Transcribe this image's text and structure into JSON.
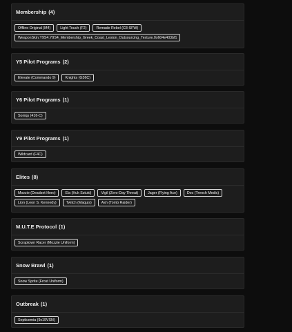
{
  "sections": [
    {
      "title": "Membership",
      "count": "(4)",
      "items": [
        "Offline Original (M4)",
        "Light Touch (F2)",
        "Remade Rebel (C8-SFW)",
        "WeaponSkin.Y9S4.Y9S4_Membership_Greek_Coast_Lesion_Outsourcing_Texture.0x604e403bf1"
      ]
    },
    {
      "title": "Y5 Pilot Programs",
      "count": "(2)",
      "items": [
        "Elevate (Commando 9)",
        "Knights (G36C)"
      ]
    },
    {
      "title": "Y6 Pilot Programs",
      "count": "(1)",
      "items": [
        "Soniqs (416-C)"
      ]
    },
    {
      "title": "Y9 Pilot Programs",
      "count": "(1)",
      "items": [
        "Wildcard (F4C)"
      ]
    },
    {
      "title": "Elites",
      "count": "(8)",
      "items": [
        "Mozzie (Deadset Hero)",
        "Ela (Huk Sztuki)",
        "Vigil (Zero-Day Threat)",
        "Jager (Flying Ace)",
        "Doc (Trench Medic)",
        "Lion (Leon S. Kennedy)",
        "Twitch (Maquis)",
        "Ash (Tomb Raider)"
      ]
    },
    {
      "title": "M.U.T.E Protocol",
      "count": "(1)",
      "items": [
        "Scraptown Racer (Mozzie Uniform)"
      ]
    },
    {
      "title": "Snow Brawl",
      "count": "(1)",
      "items": [
        "Snow Sprite (Frost Uniform)"
      ]
    },
    {
      "title": "Outbreak",
      "count": "(1)",
      "items": [
        "Septicemia (9x19VSN)"
      ]
    }
  ]
}
